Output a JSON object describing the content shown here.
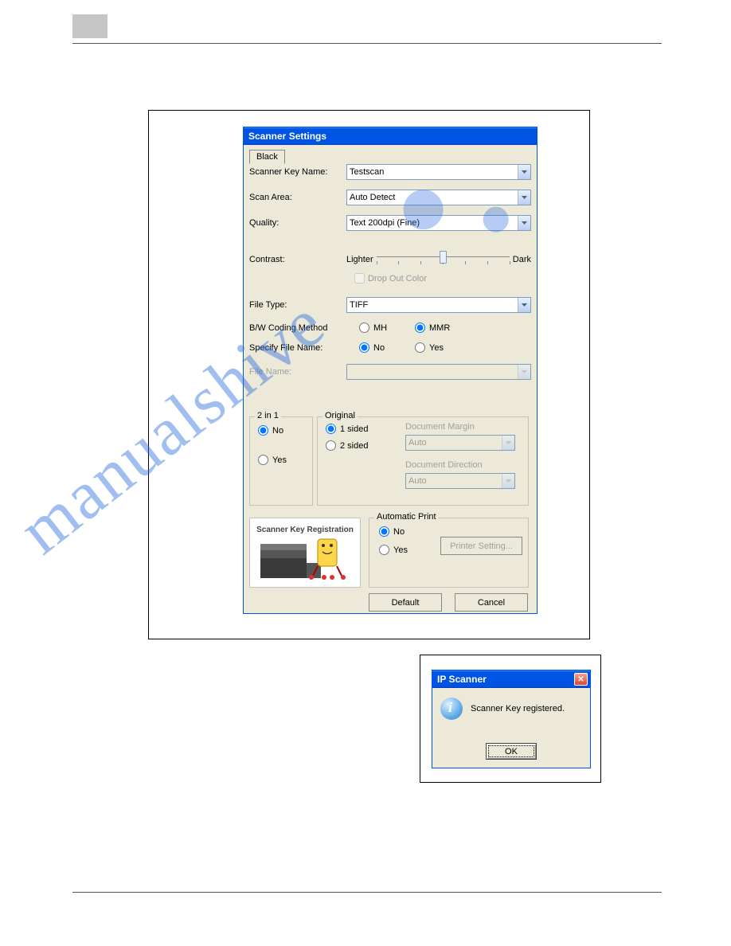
{
  "dialog": {
    "title": "Scanner Settings",
    "tab": "Black",
    "scanner_key_name_label": "Scanner Key Name:",
    "scanner_key_name_value": "Testscan",
    "scan_area_label": "Scan Area:",
    "scan_area_value": "Auto Detect",
    "quality_label": "Quality:",
    "quality_value": "Text 200dpi (Fine)",
    "contrast_label": "Contrast:",
    "contrast_lighter": "Lighter",
    "contrast_dark": "Dark",
    "dropout_label": "Drop Out Color",
    "file_type_label": "File Type:",
    "file_type_value": "TIFF",
    "bw_coding_label": "B/W Coding Method",
    "bw_mh": "MH",
    "bw_mmr": "MMR",
    "specify_file_label": "Specify File Name:",
    "no": "No",
    "yes": "Yes",
    "file_name_label": "File Name:",
    "file_name_value": "",
    "two_in_one_legend": "2 in 1",
    "original_legend": "Original",
    "one_sided": "1 sided",
    "two_sided": "2 sided",
    "doc_margin_label": "Document Margin",
    "doc_margin_value": "Auto",
    "doc_direction_label": "Document Direction",
    "doc_direction_value": "Auto",
    "scanner_key_reg": "Scanner Key Registration",
    "auto_print_legend": "Automatic Print",
    "printer_setting": "Printer Setting...",
    "default_btn": "Default",
    "cancel_btn": "Cancel"
  },
  "popup": {
    "title": "IP Scanner",
    "message": "Scanner Key registered.",
    "ok": "OK"
  }
}
